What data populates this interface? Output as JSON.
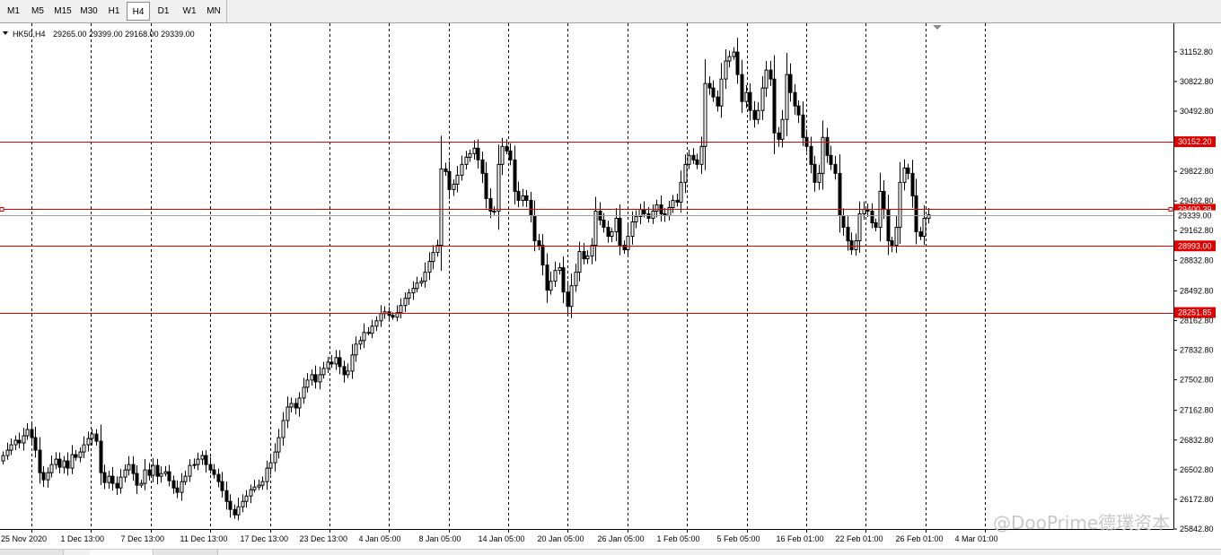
{
  "toolbar": {
    "timeframes": [
      "M1",
      "M5",
      "M15",
      "M30",
      "H1",
      "H4",
      "D1",
      "W1",
      "MN"
    ],
    "active": "H4"
  },
  "chart_header": {
    "symbol": "HK50,H4",
    "ohlc": "29265.00 29399.00 29168.00 29339.00"
  },
  "watermark": "@DooPrime德璞资本",
  "colors": {
    "level_line": "#e00000",
    "level_label_bg": "#e00000",
    "current_price_line": "#a0a0a0",
    "candle": "#000000",
    "grid": "#000000"
  },
  "chart_data": {
    "type": "candlestick",
    "title": "",
    "ylim": [
      25842.8,
      31470.0
    ],
    "y_ticks": [
      "31152.80",
      "30822.80",
      "30492.80",
      "30152.20",
      "29822.80",
      "29492.80",
      "29400.39",
      "29339.00",
      "29162.80",
      "28993.00",
      "28832.80",
      "28492.80",
      "28251.85",
      "28162.80",
      "27832.80",
      "27502.80",
      "27162.80",
      "26832.80",
      "26502.80",
      "26172.80",
      "25842.80"
    ],
    "x_labels": [
      "25 Nov 2020",
      "1 Dec 13:00",
      "7 Dec 13:00",
      "11 Dec 13:00",
      "17 Dec 13:00",
      "23 Dec 13:00",
      "4 Jan 05:00",
      "8 Jan 05:00",
      "14 Jan 05:00",
      "20 Jan 05:00",
      "26 Jan 05:00",
      "1 Feb 05:00",
      "5 Feb 05:00",
      "16 Feb 01:00",
      "22 Feb 01:00",
      "26 Feb 01:00",
      "4 Mar 01:00"
    ],
    "horizontal_levels": [
      30152.2,
      29400.39,
      28993.0,
      28251.85
    ],
    "current_price": 29339.0,
    "closes": [
      26660,
      26720,
      26780,
      26830,
      26800,
      26880,
      26950,
      26860,
      26720,
      26470,
      26390,
      26470,
      26560,
      26620,
      26530,
      26600,
      26520,
      26670,
      26640,
      26700,
      26780,
      26850,
      26900,
      26820,
      26470,
      26360,
      26430,
      26350,
      26300,
      26420,
      26500,
      26560,
      26460,
      26330,
      26350,
      26500,
      26440,
      26550,
      26430,
      26460,
      26480,
      26380,
      26300,
      26250,
      26370,
      26430,
      26550,
      26560,
      26620,
      26660,
      26560,
      26500,
      26450,
      26370,
      26270,
      26150,
      26060,
      26000,
      26090,
      26150,
      26210,
      26280,
      26310,
      26330,
      26370,
      26520,
      26580,
      26700,
      26860,
      27050,
      27200,
      27240,
      27190,
      27300,
      27420,
      27500,
      27560,
      27480,
      27560,
      27630,
      27700,
      27680,
      27750,
      27650,
      27560,
      27600,
      27780,
      27900,
      27940,
      28030,
      28020,
      28100,
      28160,
      28240,
      28260,
      28220,
      28200,
      28250,
      28330,
      28410,
      28470,
      28520,
      28580,
      28600,
      28700,
      28820,
      28920,
      29000,
      29850,
      29820,
      29620,
      29680,
      29780,
      29900,
      29980,
      30020,
      30080,
      29950,
      29800,
      29520,
      29380,
      29380,
      29900,
      30100,
      30050,
      29950,
      29600,
      29500,
      29550,
      29500,
      29330,
      29050,
      29000,
      28780,
      28500,
      28600,
      28720,
      28750,
      28480,
      28320,
      28550,
      28700,
      28930,
      28850,
      28880,
      29000,
      29380,
      29280,
      29200,
      29100,
      29150,
      29300,
      29000,
      28950,
      29100,
      29260,
      29320,
      29400,
      29350,
      29300,
      29380,
      29450,
      29350,
      29330,
      29420,
      29500,
      29480,
      29700,
      29900,
      30000,
      29950,
      29900,
      30100,
      30800,
      30750,
      30650,
      30550,
      30850,
      31050,
      31100,
      31150,
      30900,
      30600,
      30700,
      30500,
      30400,
      30500,
      30750,
      30950,
      30850,
      30250,
      30180,
      30400,
      30900,
      30700,
      30550,
      30450,
      30200,
      30100,
      29900,
      29700,
      29800,
      30200,
      30000,
      29900,
      29800,
      29330,
      29200,
      29050,
      28950,
      29050,
      29350,
      29400,
      29380,
      29250,
      29200,
      29600,
      29400,
      29050,
      29000,
      29200,
      29700,
      29860,
      29800,
      29550,
      29150,
      29100,
      29300,
      29339
    ]
  }
}
